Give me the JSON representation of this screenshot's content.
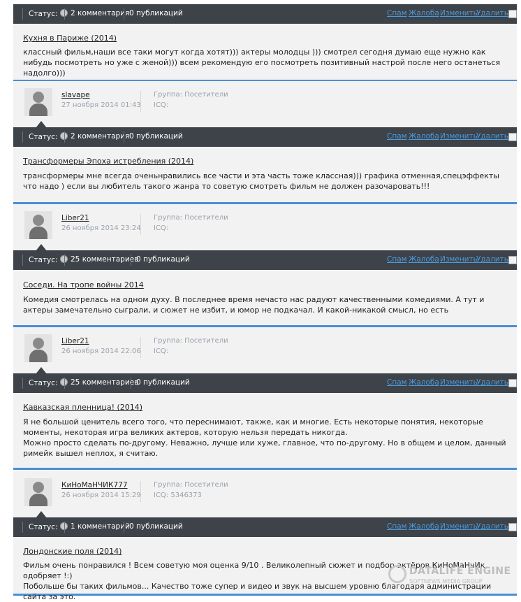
{
  "actions": {
    "spam": "Спам",
    "complaint": "Жалоба",
    "edit": "Изменить",
    "delete": "Удалить"
  },
  "status_label": "Статус:",
  "comments": [
    {
      "bar": {
        "comments": "2 комментария",
        "publications": "0 публикаций"
      },
      "title": "Кухня в Париже (2014)",
      "text": "классный фильм,наши все таки могут когда хотят))) актеры молодцы ))) смотрел сегодня думаю еще нужно как нибудь посмотреть но уже с женой))) всем рекомендую его посмотреть позитивный настрой после него останеться надолго)))"
    },
    {
      "user": {
        "name": "slavape",
        "date": "27 ноября 2014 01:43",
        "group": "Группа: Посетители",
        "icq": "ICQ:"
      },
      "bar": {
        "comments": "2 комментария",
        "publications": "0 публикаций"
      },
      "title": "Трансформеры Эпоха истребления (2014)",
      "text": "трансформеры мне всегда оченьнравились все части и эта часть тоже классная))) графика отменная,спецэффекты что надо ) если вы любитель такого жанра то советую смотреть фильм не должен разочаровать!!!"
    },
    {
      "user": {
        "name": "Liber21",
        "date": "26 ноября 2014 23:24",
        "group": "Группа: Посетители",
        "icq": "ICQ:"
      },
      "bar": {
        "comments": "25 комментариев",
        "publications": "0 публикаций"
      },
      "title": "Соседи. На тропе войны 2014",
      "text": "Комедия смотрелась на одном духу. В последнее время нечасто нас радуют качественными комедиями. А тут и актеры замечательно сыграли, и сюжет не избит, и юмор не подкачал. И какой-никакой смысл, но есть"
    },
    {
      "user": {
        "name": "Liber21",
        "date": "26 ноября 2014 22:06",
        "group": "Группа: Посетители",
        "icq": "ICQ:"
      },
      "bar": {
        "comments": "25 комментариев",
        "publications": "0 публикаций"
      },
      "title": "Кавказская пленница! (2014)",
      "text": "Я не большой ценитель всего того, что переснимают, также, как и многие. Есть некоторые понятия, некоторые моменты, некоторая игра великих актеров, которую нельзя передать никогда.\nМожно просто сделать по-другому. Неважно, лучше или хуже, главное, что по-другому. Но в общем и целом, данный римейк вышел неплох, я считаю."
    },
    {
      "user": {
        "name": "КиНоМаНЧИК777",
        "date": "26 ноября 2014 15:29",
        "group": "Группа: Посетители",
        "icq": "ICQ: 5346373"
      },
      "bar": {
        "comments": "1 комментарий",
        "publications": "0 публикаций"
      },
      "title": "Лондонские поля (2014)",
      "text": "Фильм очень понравился ! Всем советую моя оценка 9/10 . Великолепный сюжет и подбор актёров КиНоМаНчИк одобряет !:)\nПобольше бы таких фильмов... Качество тоже супер и видео и звук на высшем уровню благодаря администрации сайта за это."
    }
  ],
  "watermark": {
    "title": "DATALIFE ENGINE",
    "subtitle": "SOFTNEWS MEDIA GROUP"
  },
  "colors": {
    "bar": "#3d4349",
    "panel": "#f2f2f2",
    "accent": "#4a8fd4",
    "link": "#4a9be0"
  }
}
